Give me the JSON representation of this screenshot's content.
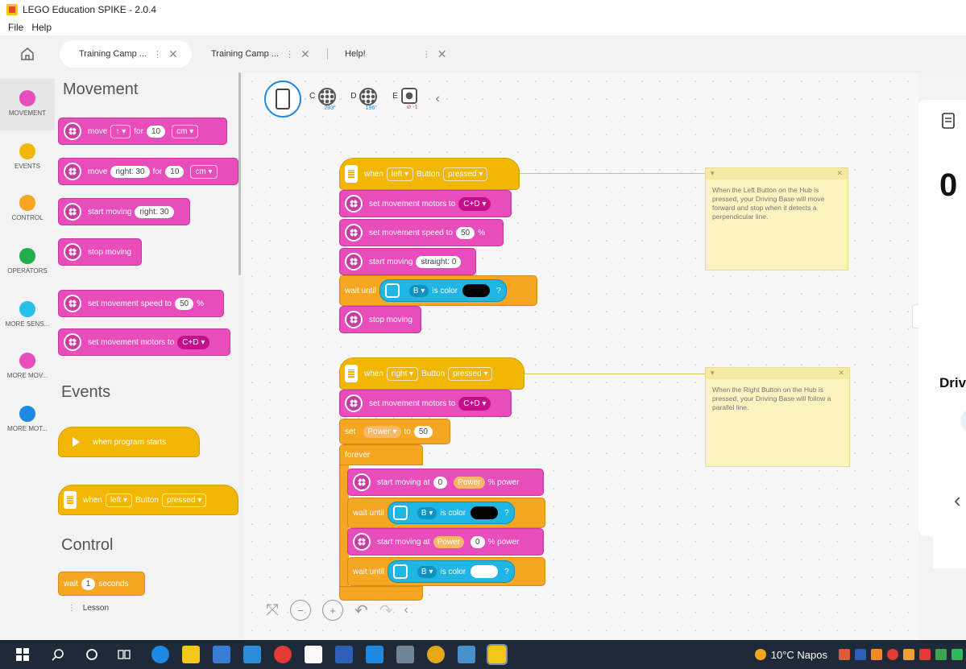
{
  "window": {
    "title": "LEGO Education SPIKE - 2.0.4"
  },
  "menu": {
    "file": "File",
    "help": "Help"
  },
  "tabs": [
    {
      "label": "Training Camp ...",
      "kebab": "⋮",
      "close": "✕"
    },
    {
      "label": "Training Camp ...",
      "kebab": "⋮",
      "close": "✕"
    },
    {
      "label": "Help!",
      "kebab": "⋮",
      "close": "✕"
    }
  ],
  "categories": [
    {
      "label": "MOVEMENT",
      "color": "#e84dbb"
    },
    {
      "label": "EVENTS",
      "color": "#f2b705"
    },
    {
      "label": "CONTROL",
      "color": "#f5a623"
    },
    {
      "label": "OPERATORS",
      "color": "#1fae4b"
    },
    {
      "label": "MORE SENS...",
      "color": "#27c0ea"
    },
    {
      "label": "MORE MOV...",
      "color": "#e84dbb"
    },
    {
      "label": "MORE MOT...",
      "color": "#1e88e5"
    }
  ],
  "palette": {
    "movement_title": "Movement",
    "events_title": "Events",
    "control_title": "Control",
    "move1": {
      "text": "move",
      "dir": "↑ ▾",
      "for": "for",
      "value": "10",
      "unit": "cm ▾"
    },
    "move2": {
      "text": "move",
      "steer": "right: 30",
      "for": "for",
      "value": "10",
      "unit": "cm ▾"
    },
    "start_moving": {
      "text": "start moving",
      "steer": "right: 30"
    },
    "stop_moving": "stop moving",
    "set_speed": {
      "text": "set movement speed to",
      "value": "50",
      "unit": "%"
    },
    "set_motors": {
      "text": "set movement motors to",
      "value": "C+D ▾"
    },
    "when_program_starts": "when program starts",
    "when_button": {
      "when": "when",
      "side": "left ▾",
      "button": "Button",
      "state": "pressed ▾"
    },
    "wait": {
      "text": "wait",
      "value": "1",
      "unit": "seconds"
    },
    "lesson": "Lesson"
  },
  "ports": {
    "c": {
      "label": "C",
      "value": "283°"
    },
    "d": {
      "label": "D",
      "value": "196°"
    },
    "e": {
      "label": "E",
      "value": "⊘ -1"
    }
  },
  "script1": {
    "when": "when",
    "side": "left ▾",
    "button": "Button",
    "state": "pressed ▾",
    "set_motors": "set movement motors to",
    "motors": "C+D ▾",
    "set_speed": "set movement speed to",
    "speed": "50",
    "pct": "%",
    "start_moving": "start moving",
    "steer": "straight: 0",
    "wait_until": "wait until",
    "port": "B ▾",
    "is_color": "is color",
    "q": "?",
    "stop_moving": "stop moving"
  },
  "script2": {
    "when": "when",
    "side": "right ▾",
    "button": "Button",
    "state": "pressed ▾",
    "set_motors": "set movement motors to",
    "motors": "C+D ▾",
    "set": "set",
    "var": "Power ▾",
    "to": "to",
    "value": "50",
    "forever": "forever",
    "start_at1": "start moving at",
    "a1": "0",
    "b1": "Power",
    "power1": "% power",
    "wait_until1": "wait until",
    "port1": "B ▾",
    "is_color1": "is color",
    "q1": "?",
    "start_at2": "start moving at",
    "a2": "Power",
    "b2": "0",
    "power2": "% power",
    "wait_until2": "wait until",
    "port2": "B ▾",
    "is_color2": "is color",
    "q2": "?"
  },
  "comment1": {
    "text": "When the Left Button on the Hub is pressed, your Driving Base will move forward and stop when it detects a perpendicular line."
  },
  "comment2": {
    "text": "When the Right Button on the Hub is pressed, your Driving Base will follow a parallel line."
  },
  "right_panel": {
    "big": "0",
    "label": "Driv"
  },
  "taskbar": {
    "weather": "10°C Napos"
  }
}
